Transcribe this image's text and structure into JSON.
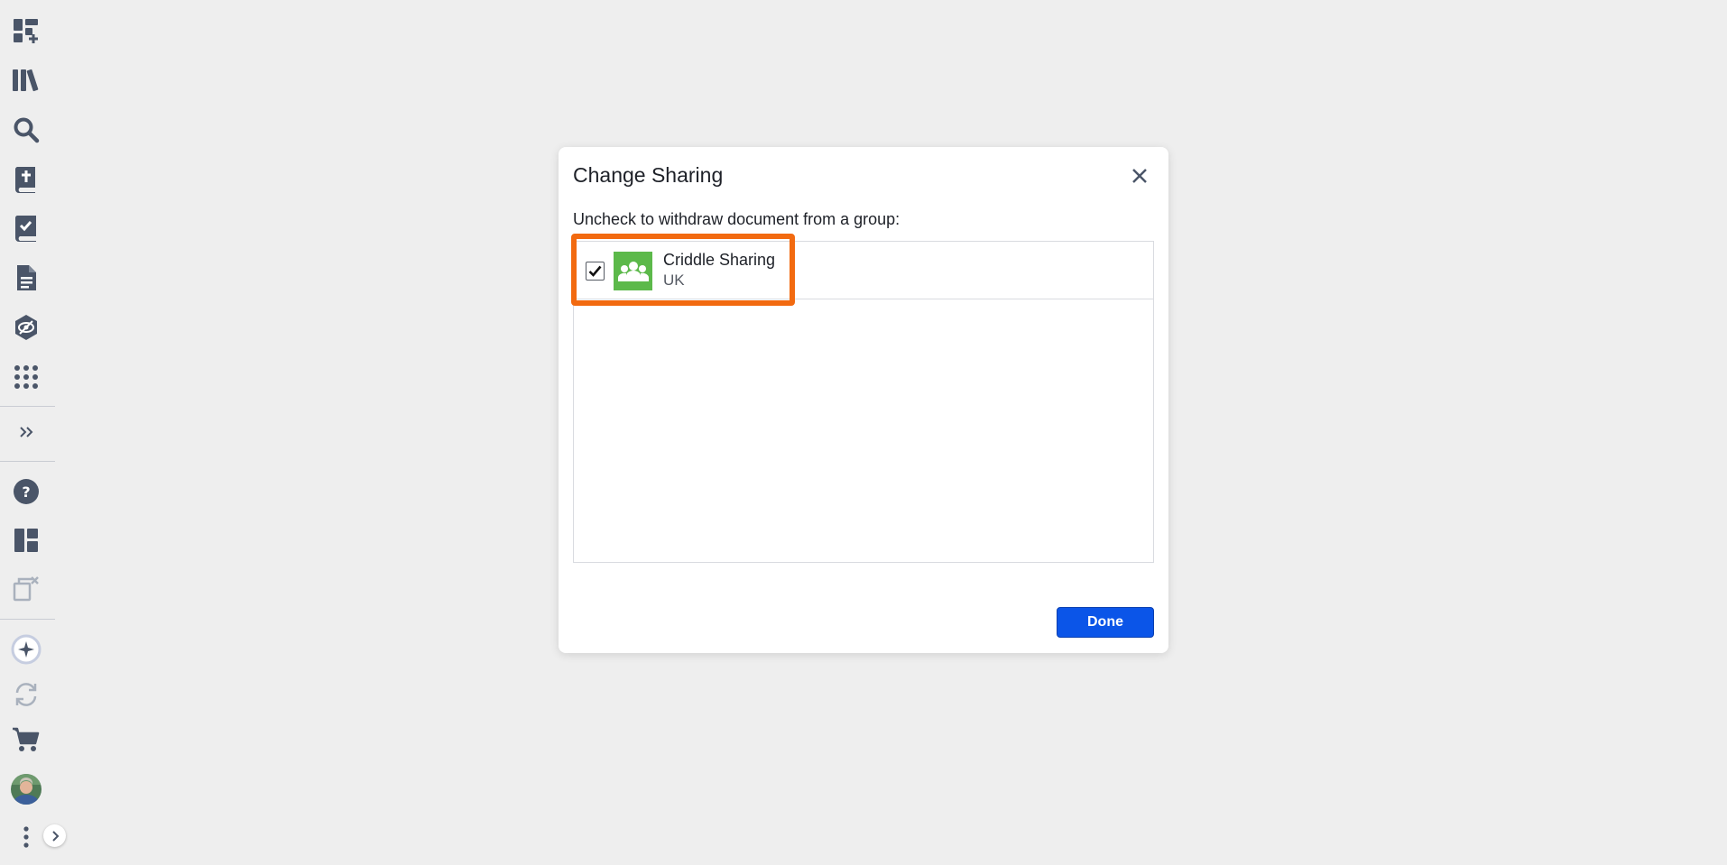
{
  "sidebar": {
    "icons": [
      {
        "name": "dashboard-add-icon"
      },
      {
        "name": "library-icon"
      },
      {
        "name": "search-icon"
      },
      {
        "name": "bible-icon"
      },
      {
        "name": "tasks-icon"
      },
      {
        "name": "document-icon"
      },
      {
        "name": "visual-filter-icon"
      },
      {
        "name": "apps-grid-icon"
      },
      {
        "name": "expand-chevrons-icon"
      },
      {
        "name": "help-icon"
      },
      {
        "name": "layouts-icon"
      },
      {
        "name": "close-panels-icon"
      },
      {
        "name": "ai-assistant-icon"
      },
      {
        "name": "sync-icon"
      },
      {
        "name": "cart-icon"
      },
      {
        "name": "user-avatar"
      },
      {
        "name": "more-vertical-icon"
      }
    ],
    "colors": {
      "icon": "#4a5568",
      "disabled_icon": "#a9b1bd",
      "divider": "#c9ccd3"
    }
  },
  "modal": {
    "title": "Change Sharing",
    "instruction": "Uncheck to withdraw document from a group:",
    "groups": [
      {
        "name": "Criddle Sharing",
        "subtitle": "UK",
        "checked": true,
        "avatar_color": "#5cb94a",
        "icon": "group-people-icon"
      }
    ],
    "done_label": "Done",
    "highlight_color": "#f26a10",
    "button_color": "#0b55e8"
  }
}
